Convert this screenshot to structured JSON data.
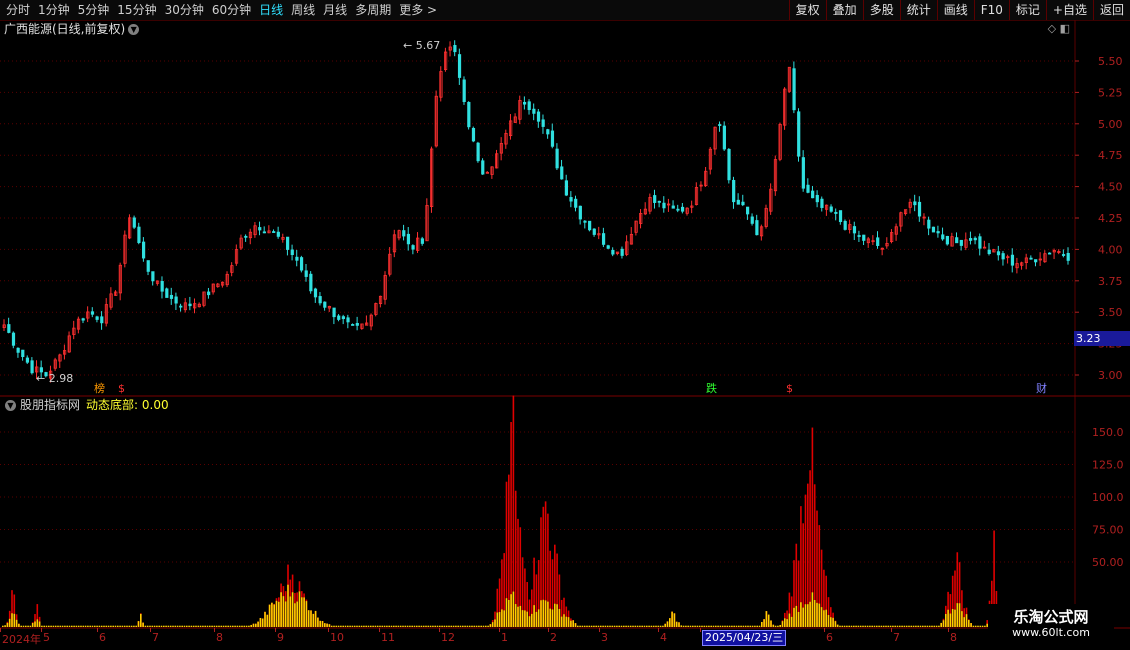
{
  "toolbar": {
    "periods": [
      "分时",
      "1分钟",
      "5分钟",
      "15分钟",
      "30分钟",
      "60分钟",
      "日线",
      "周线",
      "月线",
      "多周期",
      "更多 >"
    ],
    "active_period": "日线",
    "right_buttons": [
      "复权",
      "叠加",
      "多股",
      "统计",
      "画线",
      "F10",
      "标记",
      "+自选",
      "返回"
    ]
  },
  "main": {
    "title": "广西能源(日线,前复权)",
    "high_label": "5.67",
    "low_label": "2.98",
    "current_price": "3.23",
    "y_ticks": [
      "5.50",
      "5.25",
      "5.00",
      "4.75",
      "4.50",
      "4.25",
      "4.00",
      "3.75",
      "3.50",
      "3.25",
      "3.00"
    ],
    "markers": [
      {
        "text": "榜",
        "color": "#ff9900",
        "x": 98
      },
      {
        "text": "$",
        "color": "#ff3030",
        "x": 122
      },
      {
        "text": "跌",
        "color": "#30ff30",
        "x": 710
      },
      {
        "text": "$",
        "color": "#ff3030",
        "x": 790
      },
      {
        "text": "财",
        "color": "#8080ff",
        "x": 1040
      }
    ]
  },
  "indicator": {
    "source": "股朋指标网",
    "label": "动态底部",
    "value": "0.00",
    "y_ticks": [
      "150.0",
      "125.0",
      "100.0",
      "75.00",
      "50.00"
    ]
  },
  "xaxis": {
    "labels": [
      "2024年",
      "5",
      "6",
      "7",
      "8",
      "9",
      "10",
      "11",
      "12",
      "1",
      "2",
      "3",
      "4",
      "5",
      "6",
      "7",
      "8",
      "9"
    ],
    "cursor_date": "2025/04/23/三"
  },
  "watermark": {
    "line1": "乐淘公式网",
    "line2": "www.60lt.com"
  },
  "colors": {
    "up": "#ff3030",
    "down": "#30e0e0",
    "grid": "#5a0000",
    "bar_red": "#e00000",
    "bar_yellow": "#ffd000"
  },
  "chart_data": [
    {
      "type": "candlestick",
      "title": "广西能源(日线,前复权)",
      "ylim": [
        2.9,
        5.7
      ],
      "series_close_approx": [
        3.4,
        3.2,
        3.05,
        3.0,
        3.15,
        3.4,
        3.5,
        3.45,
        3.7,
        4.3,
        3.9,
        3.7,
        3.6,
        3.55,
        3.6,
        3.7,
        3.8,
        4.1,
        4.2,
        4.15,
        4.05,
        3.9,
        3.65,
        3.55,
        3.45,
        3.35,
        3.4,
        3.7,
        4.2,
        4.0,
        4.1,
        5.4,
        5.65,
        5.1,
        4.6,
        4.7,
        4.95,
        5.2,
        5.1,
        4.85,
        4.5,
        4.3,
        4.15,
        4.05,
        3.95,
        4.2,
        4.4,
        4.35,
        4.3,
        4.35,
        4.6,
        5.1,
        4.4,
        4.3,
        4.1,
        4.6,
        5.5,
        4.5,
        4.35,
        4.3,
        4.2,
        4.1,
        4.05,
        4.0,
        4.3,
        4.35,
        4.2,
        4.1,
        4.05,
        4.1,
        4.0,
        3.95,
        3.9,
        3.9,
        3.95,
        4.0,
        3.95
      ],
      "high": 5.67,
      "low": 2.98
    },
    {
      "type": "bar",
      "title": "动态底部",
      "ylim": [
        0,
        170
      ],
      "series": [
        {
          "name": "red",
          "peaks": [
            {
              "x": "2025-01",
              "value": 160
            },
            {
              "x": "2025-02",
              "value": 100
            },
            {
              "x": "2025-07",
              "value": 155
            },
            {
              "x": "2025-09",
              "value": 65
            }
          ]
        },
        {
          "name": "yellow",
          "peaks": [
            {
              "x": "2024-09",
              "value": 30
            },
            {
              "x": "2025-01",
              "value": 25
            },
            {
              "x": "2025-07",
              "value": 25
            }
          ]
        }
      ]
    }
  ]
}
